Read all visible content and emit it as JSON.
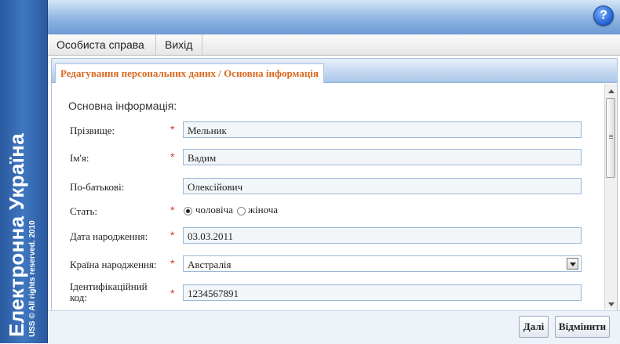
{
  "sidebar": {
    "brand": "Електронна Україна",
    "copyright": "USS © All rights reserved. 2010"
  },
  "header": {
    "help_label": "?"
  },
  "menu": {
    "personal_case": "Особиста справа",
    "exit": "Вихід"
  },
  "tab": {
    "title": "Редагування персональних даних / Основна інформація"
  },
  "form": {
    "section_title": "Основна інформація:",
    "required_mark": "*",
    "surname_label": "Прізвище:",
    "surname_value": "Мельник",
    "name_label": "Ім'я:",
    "name_value": "Вадим",
    "patronymic_label": "По-батькові:",
    "patronymic_value": "Олексійович",
    "gender_label": "Стать:",
    "gender_male": "чоловіча",
    "gender_female": "жіноча",
    "gender_selected": "чоловіча",
    "birthdate_label": "Дата народження:",
    "birthdate_value": "03.03.2011",
    "country_label": "Країна народження:",
    "country_value": "Австралія",
    "id_label": "Ідентифікаційний код:",
    "id_value": "1234567891"
  },
  "buttons": {
    "next": "Далі",
    "cancel": "Відмінити"
  }
}
